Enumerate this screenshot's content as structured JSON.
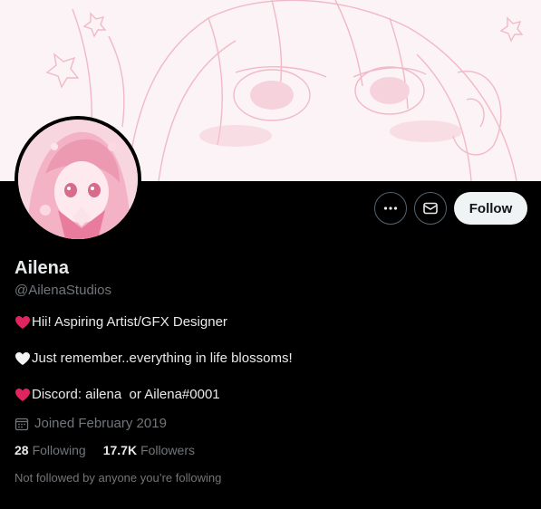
{
  "profile": {
    "display_name": "Ailena",
    "handle": "@AilenaStudios",
    "bio_lines": [
      {
        "text": "Hii! Aspiring Artist/GFX Designer",
        "heart_color": "#e0245e"
      },
      {
        "text": "Just remember..everything in life blossoms!",
        "heart_color": "#f5f5f5"
      },
      {
        "text": "Discord: ailena  or Ailena#0001",
        "heart_color": "#e0245e"
      }
    ],
    "joined": "Joined February 2019",
    "following_count": "28",
    "following_label": "Following",
    "followers_count": "17.7K",
    "followers_label": "Followers",
    "mutual_note": "Not followed by anyone you’re following"
  },
  "actions": {
    "more_icon": "more-horizontal-icon",
    "message_icon": "envelope-icon",
    "follow_label": "Follow"
  },
  "colors": {
    "background": "#000000",
    "text_primary": "#e7e9ea",
    "text_secondary": "#71767b",
    "follow_button_bg": "#eff3f4",
    "banner_tint": "#f3b9c8"
  }
}
